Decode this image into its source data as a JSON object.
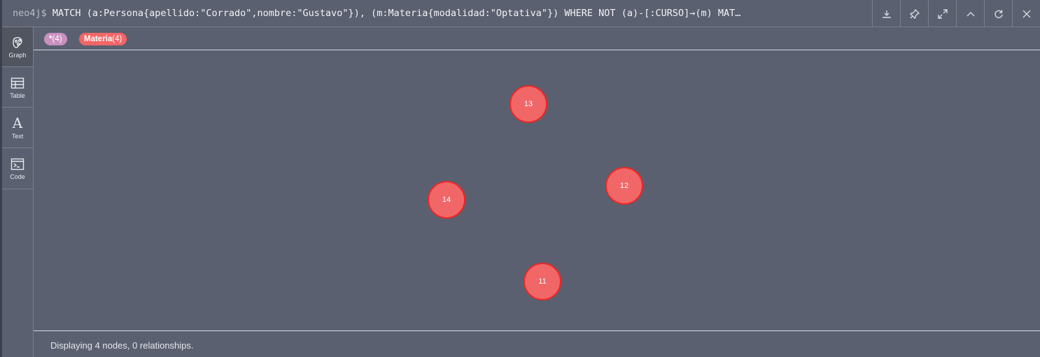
{
  "query": {
    "prompt": "neo4j$",
    "text": "MATCH (a:Persona{apellido:\"Corrado\",nombre:\"Gustavo\"}), (m:Materia{modalidad:\"Optativa\"}) WHERE NOT (a)-[:CURSO]→(m) MAT…"
  },
  "toolbar": {
    "icons": [
      "download-icon",
      "pin-icon",
      "expand-icon",
      "collapse-icon",
      "rerun-icon",
      "close-icon"
    ]
  },
  "sidebar": {
    "items": [
      {
        "label": "Graph",
        "icon": "graph-icon"
      },
      {
        "label": "Table",
        "icon": "table-icon"
      },
      {
        "label": "Text",
        "icon": "text-icon"
      },
      {
        "label": "Code",
        "icon": "code-icon"
      }
    ]
  },
  "legend": {
    "all_label": "*",
    "all_count": "(4)",
    "materia_label": "Materia",
    "materia_count": "(4)",
    "colors": {
      "all": "#c990c0",
      "materia": "#f16667"
    }
  },
  "graph": {
    "nodes": [
      {
        "id": "13"
      },
      {
        "id": "12"
      },
      {
        "id": "14"
      },
      {
        "id": "11"
      }
    ]
  },
  "status": {
    "text": "Displaying 4 nodes, 0 relationships."
  }
}
